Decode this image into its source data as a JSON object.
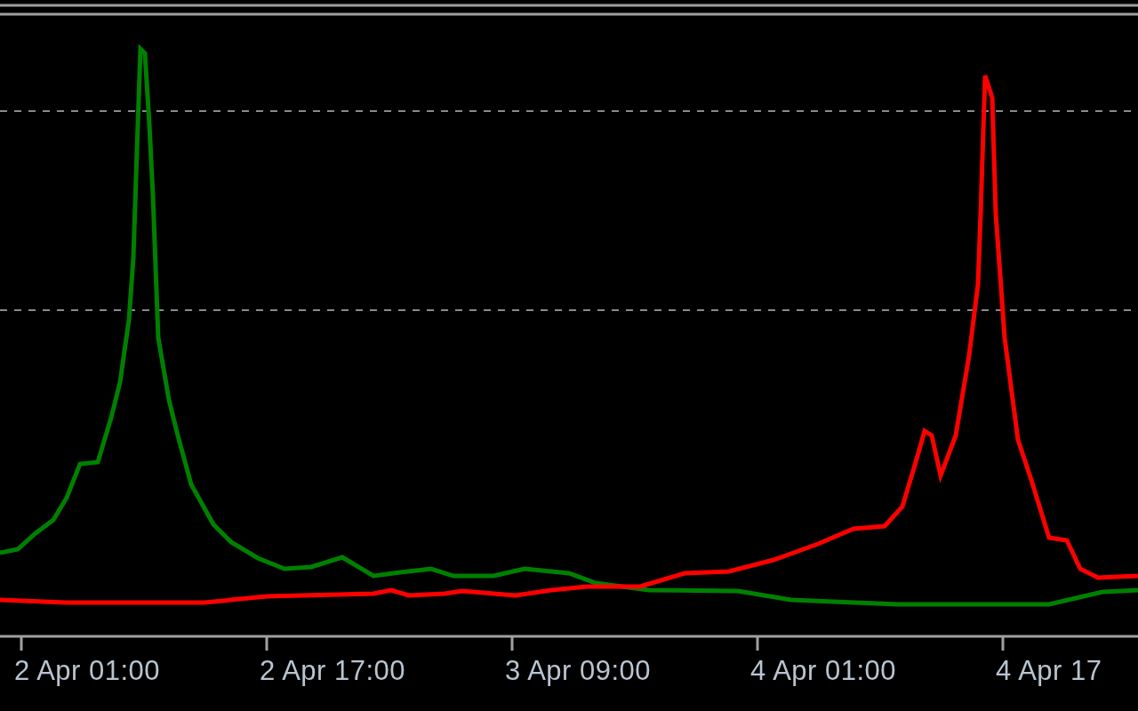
{
  "x_axis": {
    "labels": [
      "2 Apr 01:00",
      "2 Apr 17:00",
      "3 Apr 09:00",
      "4 Apr 01:00",
      "4 Apr 17"
    ]
  }
}
